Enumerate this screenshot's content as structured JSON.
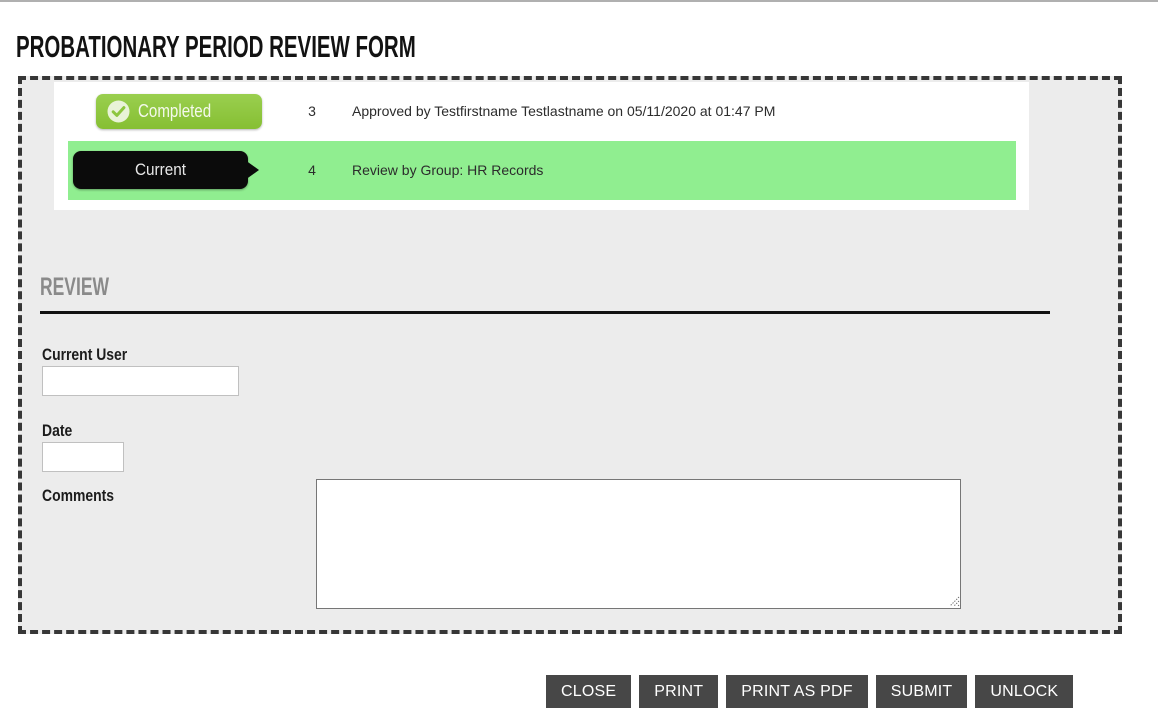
{
  "page": {
    "title": "PROBATIONARY PERIOD REVIEW FORM"
  },
  "status_panel": {
    "rows": [
      {
        "badge": "Completed",
        "badge_type": "completed",
        "icon": "check-circle-icon",
        "order": "3",
        "description": "Approved by Testfirstname Testlastname on 05/11/2020 at 01:47 PM"
      },
      {
        "badge": "Current",
        "badge_type": "current",
        "order": "4",
        "description": "Review by Group: HR Records"
      }
    ]
  },
  "section": {
    "title": "REVIEW"
  },
  "fields": {
    "current_user": {
      "label": "Current User",
      "value": "",
      "placeholder": ""
    },
    "date": {
      "label": "Date",
      "value": "",
      "placeholder": ""
    },
    "comments": {
      "label": "Comments",
      "value": "",
      "placeholder": ""
    }
  },
  "buttons": [
    {
      "label": "CLOSE",
      "name": "close-button"
    },
    {
      "label": "PRINT",
      "name": "print-button"
    },
    {
      "label": "PRINT AS PDF",
      "name": "print-as-pdf-button"
    },
    {
      "label": "SUBMIT",
      "name": "submit-button"
    },
    {
      "label": "UNLOCK",
      "name": "unlock-button"
    }
  ],
  "colors": {
    "completed_badge": "#8dc63f",
    "current_badge": "#0b0b0b",
    "current_row_highlight": "#90ee90",
    "form_background": "#ececec",
    "button_background": "#474747",
    "section_title": "#8a8a8a"
  }
}
